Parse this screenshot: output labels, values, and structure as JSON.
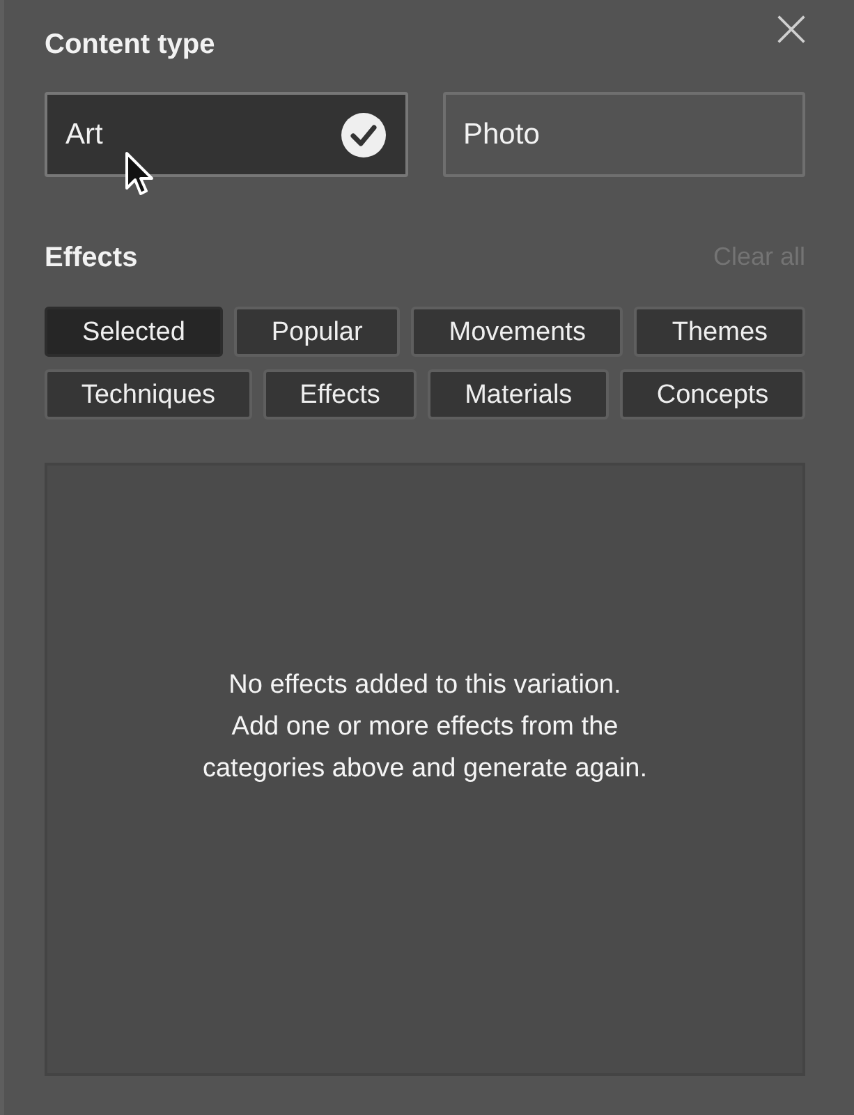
{
  "content_type": {
    "title": "Content type",
    "options": [
      {
        "label": "Art",
        "selected": true
      },
      {
        "label": "Photo",
        "selected": false
      }
    ]
  },
  "effects": {
    "title": "Effects",
    "clear_label": "Clear all",
    "categories": [
      {
        "label": "Selected",
        "selected": true
      },
      {
        "label": "Popular",
        "selected": false
      },
      {
        "label": "Movements",
        "selected": false
      },
      {
        "label": "Themes",
        "selected": false
      },
      {
        "label": "Techniques",
        "selected": false
      },
      {
        "label": "Effects",
        "selected": false
      },
      {
        "label": "Materials",
        "selected": false
      },
      {
        "label": "Concepts",
        "selected": false
      }
    ],
    "empty_message": [
      "No effects added to this variation.",
      "Add one or more effects from the",
      "categories above and generate again."
    ]
  }
}
